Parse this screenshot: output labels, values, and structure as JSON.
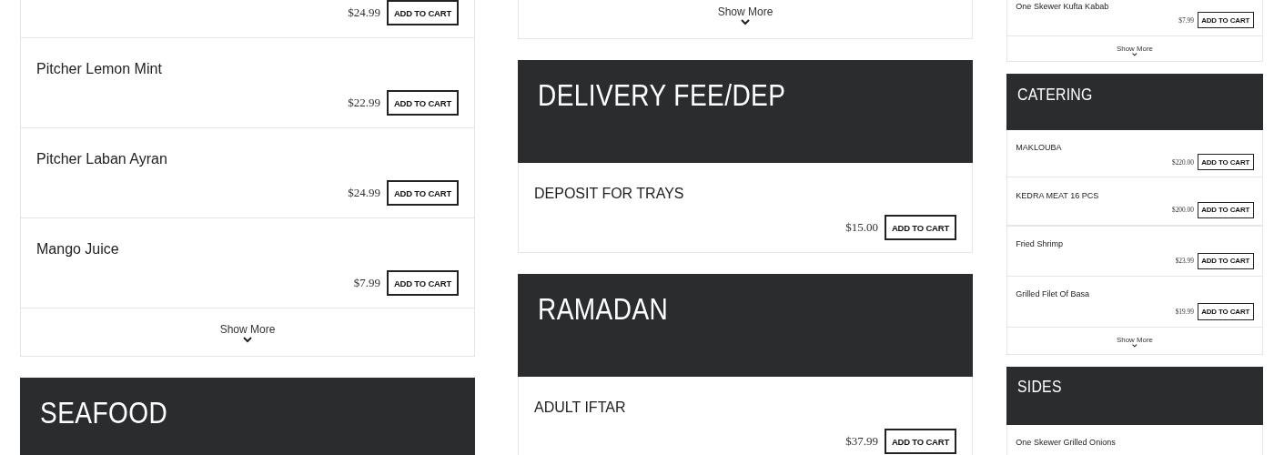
{
  "columns": [
    {
      "stacks": [
        [
          {
            "kind": "item",
            "price": "$24.99",
            "button": "ADD TO CART"
          },
          {
            "kind": "item",
            "name": "Pitcher Lemon Mint",
            "price": "$22.99",
            "button": "ADD TO CART"
          },
          {
            "kind": "item",
            "name": "Pitcher Laban Ayran",
            "price": "$24.99",
            "button": "ADD TO CART"
          },
          {
            "kind": "item",
            "name": "Mango Juice",
            "price": "$7.99",
            "button": "ADD TO CART"
          },
          {
            "kind": "more",
            "label": "Show More"
          },
          {
            "kind": "header",
            "title": "SEAFOOD"
          }
        ]
      ]
    },
    {
      "stacks": [
        [
          {
            "kind": "more",
            "label": "Show More"
          },
          {
            "kind": "header",
            "title": "DELIVERY FEE/DEP"
          },
          {
            "kind": "item",
            "name": "DEPOSIT FOR TRAYS",
            "price": "$15.00",
            "button": "ADD TO CART"
          },
          {
            "kind": "header",
            "title": "RAMADAN"
          },
          {
            "kind": "item",
            "name": "ADULT IFTAR",
            "price": "$37.99",
            "button": "ADD TO CART"
          }
        ]
      ]
    },
    {
      "stacks": [
        [
          {
            "kind": "item",
            "name": "One Skewer Kufta Kabab",
            "price": "$7.99",
            "button": "ADD TO CART"
          },
          {
            "kind": "more",
            "label": "Show More"
          },
          {
            "kind": "header",
            "title": "CATERING"
          },
          {
            "kind": "item",
            "name": "MAKLOUBA",
            "price": "$220.00",
            "button": "ADD TO CART"
          },
          {
            "kind": "item",
            "name": "KEDRA MEAT 16 PCS",
            "price": "$200.00",
            "button": "ADD TO CART"
          }
        ],
        [
          {
            "kind": "item",
            "name": "Fried Shrimp",
            "price": "$23.99",
            "button": "ADD TO CART"
          },
          {
            "kind": "item",
            "name": "Grilled Filet Of Basa",
            "price": "$19.99",
            "button": "ADD TO CART"
          },
          {
            "kind": "more",
            "label": "Show More"
          },
          {
            "kind": "header",
            "title": "SIDES"
          },
          {
            "kind": "item",
            "name": "One Skewer Grilled Onions"
          }
        ]
      ]
    }
  ]
}
